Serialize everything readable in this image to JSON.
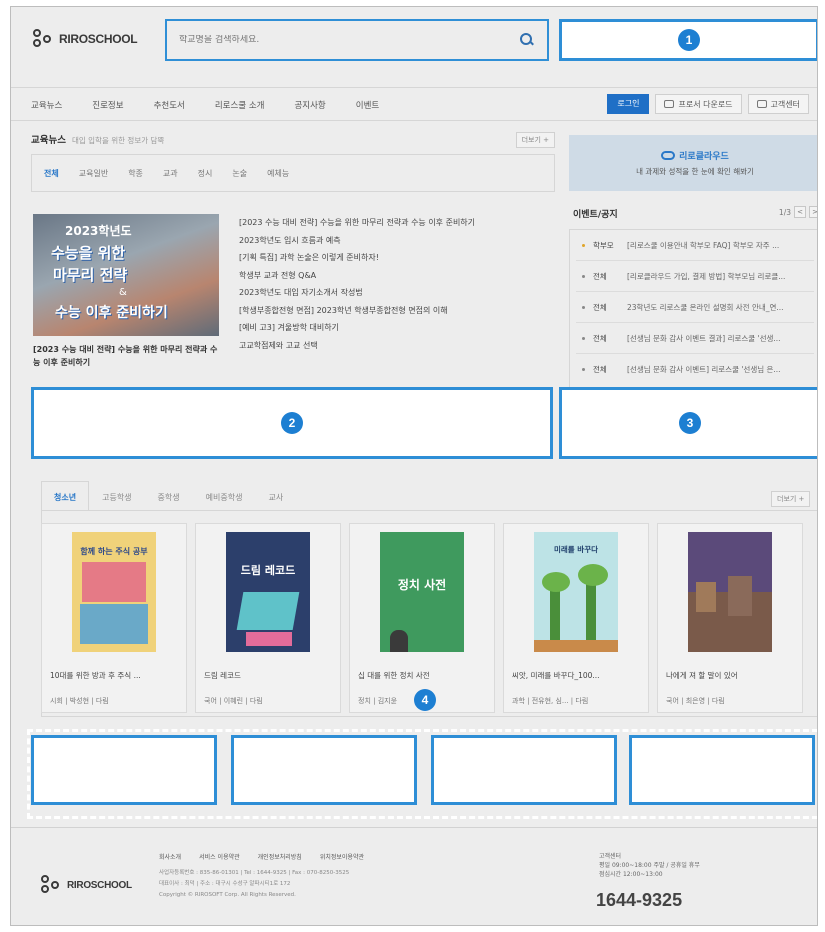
{
  "header": {
    "logo_text": "RIROSCHOOL",
    "search_placeholder": "학교명을 검색하세요."
  },
  "nav": {
    "items": [
      "교육뉴스",
      "진로정보",
      "추천도서",
      "리로스쿨 소개",
      "공지사항",
      "이벤트"
    ],
    "login": "로그인",
    "download": "프로서 다운로드",
    "support": "고객센터"
  },
  "edu_news": {
    "title": "교육뉴스",
    "subtitle": "대입 입학을 위한 정보가 담뿍",
    "more": "더보기 +",
    "tabs": [
      "전체",
      "교육일반",
      "학종",
      "교과",
      "정시",
      "논술",
      "예체능"
    ],
    "image_text": {
      "year": "2023학년도",
      "line1": "수능을 위한",
      "line2": "마무리 전략",
      "amp": "&",
      "line3": "수능 이후 준비하기"
    },
    "caption": "[2023 수능 대비 전략] 수능을 위한 마무리 전략과 수능 이후 준비하기",
    "list": [
      "[2023 수능 대비 전략] 수능을 위한 마무리 전략과 수능 이후 준비하기",
      "2023학년도 입시 흐름과 예측",
      "[기획 특집] 과학 논술은 이렇게 준비하자!",
      "학생부 교과 전형 Q&A",
      "2023학년도 대입 자기소개서 작성법",
      "[학생부종합전형 면접] 2023학년 학생부종합전형 면접의 이해",
      "[예비 고3] 겨울방학 대비하기",
      "고교학점제와 고교 선택"
    ]
  },
  "cloud": {
    "title": "리로클라우드",
    "subtitle": "내 과제와 성적을 한 눈에 확인 해봐기"
  },
  "events": {
    "title": "이벤트/공지",
    "pager": "1/3",
    "prev": "<",
    "next": ">",
    "rows": [
      {
        "cat": "학부모",
        "text": "[리로스쿨 이용안내 학부모 FAQ] 학부모 자주 ..."
      },
      {
        "cat": "전체",
        "text": "[리로클라우드 가입, 결제 방법] 학부모님 리로클..."
      },
      {
        "cat": "전체",
        "text": "23학년도 리로스쿨 온라인 설명회 사전 안내_연..."
      },
      {
        "cat": "전체",
        "text": "[선생님 문화 감사 이벤트 결과] 리로스쿨 '선생..."
      },
      {
        "cat": "전체",
        "text": "[선생님 문화 감사 이벤트] 리로스쿨 '선생님 은..."
      }
    ]
  },
  "badges": [
    "1",
    "2",
    "3",
    "4"
  ],
  "books": {
    "tabs": [
      "청소년",
      "고등학생",
      "중학생",
      "예비중학생",
      "교사"
    ],
    "more": "더보기 +",
    "items": [
      {
        "title": "10대를 위한 방과 후 주식 ...",
        "meta": "시회 | 박성현 | 다림",
        "cover_text": "함께 하는 주식 공부"
      },
      {
        "title": "드림 레코드",
        "meta": "국어 | 이혜린 | 다림",
        "cover_text": "드림 레코드"
      },
      {
        "title": "십 대를 위한 정치 사전",
        "meta": "정치 | 김지윤",
        "cover_text": "정치 사전"
      },
      {
        "title": "씨앗, 미래를 바꾸다_100...",
        "meta": "과학 | 전유현, 심... | 다림",
        "cover_text": "미래를 바꾸다"
      },
      {
        "title": "나에게 져 할 말이 있어",
        "meta": "국어 | 최은영 | 다림",
        "cover_text": ""
      }
    ]
  },
  "footer": {
    "logo_text": "RIROSCHOOL",
    "links": [
      "회사소개",
      "서비스 이용약관",
      "개인정보처리방침",
      "위치정보이용약관"
    ],
    "info1": "사업자등록번호 : 835-86-01301 | Tel : 1644-9325 | Fax : 070-8250-3525",
    "info2": "대표이사 : 최덕 | 주소 : 대구시 수성구 알파시티1로 172",
    "copyright": "Copyright © RIROSOFT Corp. All Rights Reserved.",
    "center_title": "고객센터",
    "center_hours": "평일 09:00~18:00 주말 / 공휴일 휴무",
    "center_lunch": "점심시간 12:00~13:00",
    "phone": "1644-9325"
  }
}
